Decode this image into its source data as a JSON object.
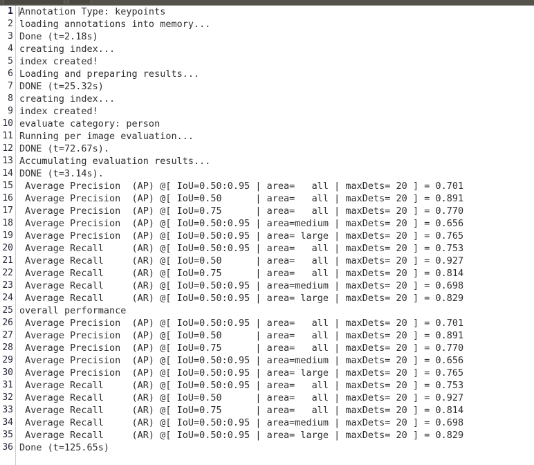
{
  "window": {
    "titlebar_color": "#55524b",
    "tabs": [
      {
        "name": "tab-primary",
        "label": ""
      },
      {
        "name": "tab-secondary",
        "label": ""
      }
    ]
  },
  "console": {
    "background_color": "#ffffff",
    "text_color": "#2e2e2e",
    "line_number_color": "#2a2a3a",
    "current_line": 1,
    "total_lines": 36,
    "lines": [
      {
        "n": "1",
        "text": "Annotation Type: keypoints"
      },
      {
        "n": "2",
        "text": "loading annotations into memory..."
      },
      {
        "n": "3",
        "text": "Done (t=2.18s)"
      },
      {
        "n": "4",
        "text": "creating index..."
      },
      {
        "n": "5",
        "text": "index created!"
      },
      {
        "n": "6",
        "text": "Loading and preparing results..."
      },
      {
        "n": "7",
        "text": "DONE (t=25.32s)"
      },
      {
        "n": "8",
        "text": "creating index..."
      },
      {
        "n": "9",
        "text": "index created!"
      },
      {
        "n": "10",
        "text": "evaluate category: person"
      },
      {
        "n": "11",
        "text": "Running per image evaluation..."
      },
      {
        "n": "12",
        "text": "DONE (t=72.67s)."
      },
      {
        "n": "13",
        "text": "Accumulating evaluation results..."
      },
      {
        "n": "14",
        "text": "DONE (t=3.14s)."
      },
      {
        "n": "15",
        "text": " Average Precision  (AP) @[ IoU=0.50:0.95 | area=   all | maxDets= 20 ] = 0.701"
      },
      {
        "n": "16",
        "text": " Average Precision  (AP) @[ IoU=0.50      | area=   all | maxDets= 20 ] = 0.891"
      },
      {
        "n": "17",
        "text": " Average Precision  (AP) @[ IoU=0.75      | area=   all | maxDets= 20 ] = 0.770"
      },
      {
        "n": "18",
        "text": " Average Precision  (AP) @[ IoU=0.50:0.95 | area=medium | maxDets= 20 ] = 0.656"
      },
      {
        "n": "19",
        "text": " Average Precision  (AP) @[ IoU=0.50:0.95 | area= large | maxDets= 20 ] = 0.765"
      },
      {
        "n": "20",
        "text": " Average Recall     (AR) @[ IoU=0.50:0.95 | area=   all | maxDets= 20 ] = 0.753"
      },
      {
        "n": "21",
        "text": " Average Recall     (AR) @[ IoU=0.50      | area=   all | maxDets= 20 ] = 0.927"
      },
      {
        "n": "22",
        "text": " Average Recall     (AR) @[ IoU=0.75      | area=   all | maxDets= 20 ] = 0.814"
      },
      {
        "n": "23",
        "text": " Average Recall     (AR) @[ IoU=0.50:0.95 | area=medium | maxDets= 20 ] = 0.698"
      },
      {
        "n": "24",
        "text": " Average Recall     (AR) @[ IoU=0.50:0.95 | area= large | maxDets= 20 ] = 0.829"
      },
      {
        "n": "25",
        "text": "overall performance"
      },
      {
        "n": "26",
        "text": " Average Precision  (AP) @[ IoU=0.50:0.95 | area=   all | maxDets= 20 ] = 0.701"
      },
      {
        "n": "27",
        "text": " Average Precision  (AP) @[ IoU=0.50      | area=   all | maxDets= 20 ] = 0.891"
      },
      {
        "n": "28",
        "text": " Average Precision  (AP) @[ IoU=0.75      | area=   all | maxDets= 20 ] = 0.770"
      },
      {
        "n": "29",
        "text": " Average Precision  (AP) @[ IoU=0.50:0.95 | area=medium | maxDets= 20 ] = 0.656"
      },
      {
        "n": "30",
        "text": " Average Precision  (AP) @[ IoU=0.50:0.95 | area= large | maxDets= 20 ] = 0.765"
      },
      {
        "n": "31",
        "text": " Average Recall     (AR) @[ IoU=0.50:0.95 | area=   all | maxDets= 20 ] = 0.753"
      },
      {
        "n": "32",
        "text": " Average Recall     (AR) @[ IoU=0.50      | area=   all | maxDets= 20 ] = 0.927"
      },
      {
        "n": "33",
        "text": " Average Recall     (AR) @[ IoU=0.75      | area=   all | maxDets= 20 ] = 0.814"
      },
      {
        "n": "34",
        "text": " Average Recall     (AR) @[ IoU=0.50:0.95 | area=medium | maxDets= 20 ] = 0.698"
      },
      {
        "n": "35",
        "text": " Average Recall     (AR) @[ IoU=0.50:0.95 | area= large | maxDets= 20 ] = 0.829"
      },
      {
        "n": "36",
        "text": "Done (t=125.65s)"
      }
    ]
  }
}
